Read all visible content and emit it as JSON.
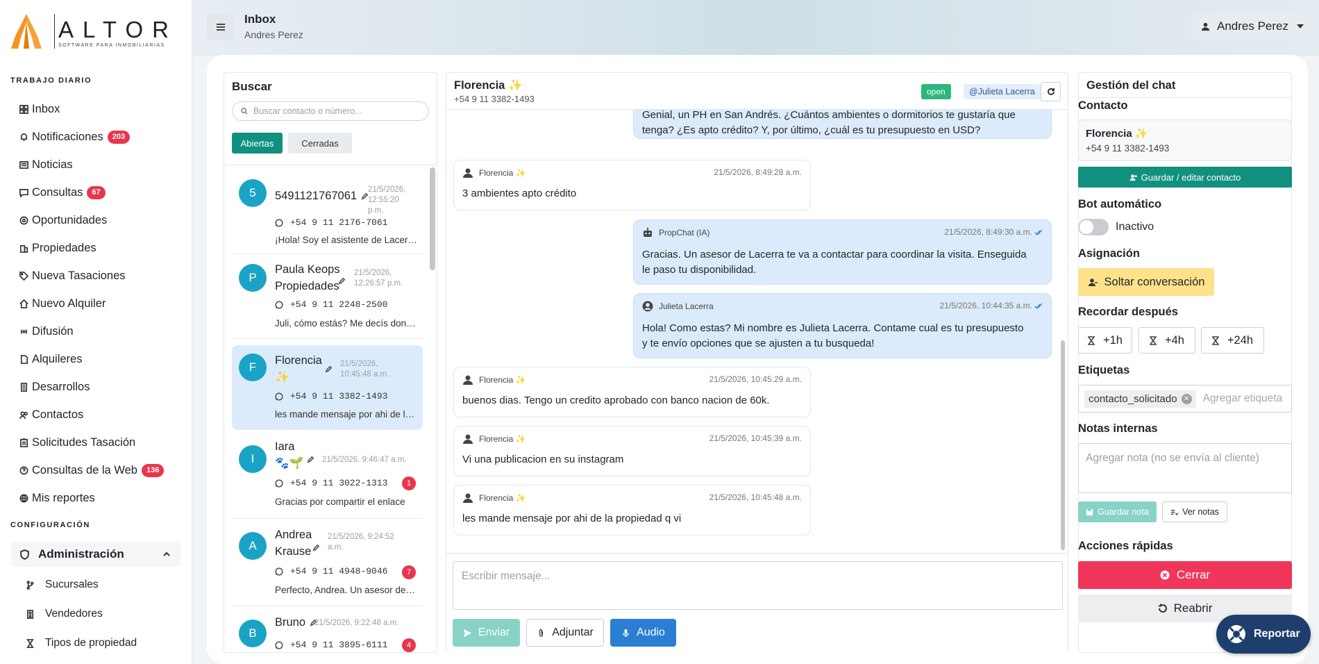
{
  "brand": {
    "name": "ALTOR",
    "tagline": "SOFTWARE PARA INMOBILIARIAS"
  },
  "sidebar": {
    "section_daily": "TRABAJO DIARIO",
    "section_config": "CONFIGURACIÓN",
    "items": [
      {
        "label": "Inbox",
        "icon": "grid-icon"
      },
      {
        "label": "Notificaciones",
        "icon": "bell-icon",
        "badge": "203"
      },
      {
        "label": "Noticias",
        "icon": "newspaper-icon"
      },
      {
        "label": "Consultas",
        "icon": "chat-icon",
        "badge": "67"
      },
      {
        "label": "Oportunidades",
        "icon": "target-icon"
      },
      {
        "label": "Propiedades",
        "icon": "building-icon"
      },
      {
        "label": "Nueva Tasaciones",
        "icon": "tag-icon"
      },
      {
        "label": "Nuevo Alquiler",
        "icon": "house-icon"
      },
      {
        "label": "Difusión",
        "icon": "broadcast-icon"
      },
      {
        "label": "Alquileres",
        "icon": "file-icon"
      },
      {
        "label": "Desarrollos",
        "icon": "building-2-icon"
      },
      {
        "label": "Contactos",
        "icon": "users-icon"
      },
      {
        "label": "Solicitudes Tasación",
        "icon": "clipboard-icon"
      },
      {
        "label": "Consultas de la Web",
        "icon": "question-icon",
        "badge": "136"
      },
      {
        "label": "Mis reportes",
        "icon": "globe-icon"
      }
    ],
    "admin_label": "Administración",
    "admin_items": [
      {
        "label": "Sucursales",
        "icon": "branch-icon"
      },
      {
        "label": "Vendedores",
        "icon": "id-card-icon"
      },
      {
        "label": "Tipos de propiedad",
        "icon": "hourglass-icon"
      }
    ]
  },
  "header": {
    "title": "Inbox",
    "subtitle": "Andres Perez",
    "user": "Andres Perez"
  },
  "list": {
    "title": "Buscar",
    "search_placeholder": "Buscar contacto o número...",
    "tab_open": "Abiertas",
    "tab_closed": "Cerradas",
    "conversations": [
      {
        "initial": "5",
        "name1": "5491121767061",
        "name2": "",
        "date1": "21/5/2026,",
        "date2": "12:55:20",
        "date3": "p.m.",
        "phone": "+54 9 11 2176-7061",
        "preview": "¡Hola! Soy el asistente de Lacerra Propiedades",
        "badge": ""
      },
      {
        "initial": "P",
        "name1": "Paula Keops",
        "name2": "Propiedades",
        "date1": "21/5/2026,",
        "date2": "12:26:57 p.m.",
        "date3": "",
        "phone": "+54 9 11 2248-2500",
        "preview": "Juli, cómo estás? Me decís donde queda",
        "badge": ""
      },
      {
        "initial": "F",
        "name1": "Florencia",
        "name2": "✨",
        "date1": "21/5/2026,",
        "date2": "10:45:48 a.m.",
        "date3": "",
        "phone": "+54 9 11 3382-1493",
        "preview": "les mande mensaje por ahi de la propiedad",
        "badge": ""
      },
      {
        "initial": "I",
        "name1": "Iara",
        "name2": "🐾🌱",
        "date1": "21/5/2026, 9:46:47 a.m.",
        "date2": "",
        "date3": "",
        "phone": "+54 9 11 3022-1313",
        "preview": "Gracias por compartir el enlace",
        "badge": "1"
      },
      {
        "initial": "A",
        "name1": "Andrea",
        "name2": "Krause",
        "date1": "21/5/2026, 9:24:52",
        "date2": "a.m.",
        "date3": "",
        "phone": "+54 9 11 4948-9046",
        "preview": "Perfecto, Andrea. Un asesor de Lacerra",
        "badge": "7"
      },
      {
        "initial": "B",
        "name1": "Bruno",
        "name2": "",
        "date1": "21/5/2026, 9:22:48 a.m.",
        "date2": "",
        "date3": "",
        "phone": "+54 9 11 3895-6111",
        "preview": "",
        "badge": "4"
      }
    ]
  },
  "chat": {
    "name": "Florencia",
    "sparkle": "✨",
    "phone": "+54 9 11 3382-1493",
    "status": "open",
    "assignee": "@Julieta Lacerra",
    "messages": [
      {
        "dir": "out",
        "sender": "",
        "time": "",
        "text1": "Genial, un PH en San Andrés. ¿Cuántos ambientes o dormitorios te gustaría que",
        "text2": "tenga? ¿Es apto crédito? Y, por último, ¿cuál es tu presupuesto en USD?"
      },
      {
        "dir": "in",
        "sender": "Florencia ✨",
        "time": "21/5/2026, 8:49:28 a.m.",
        "text1": "3 ambientes apto crédito",
        "text2": ""
      },
      {
        "dir": "out",
        "sender": "PropChat (IA)",
        "time": "21/5/2026, 8:49:30 a.m.",
        "text1": "Gracias. Un asesor de Lacerra te va a contactar para coordinar la visita. Enseguida",
        "text2": "le paso tu disponibilidad."
      },
      {
        "dir": "out",
        "sender": "Julieta Lacerra",
        "time": "21/5/2026, 10:44:35 a.m.",
        "text1": "Hola! Como estas? Mi nombre es Julieta Lacerra. Contame cual es tu presupuesto",
        "text2": "y te envío opciones que se ajusten a tu busqueda!"
      },
      {
        "dir": "in",
        "sender": "Florencia ✨",
        "time": "21/5/2026, 10:45:29 a.m.",
        "text1": "buenos dias. Tengo un credito aprobado con banco nacion de 60k.",
        "text2": ""
      },
      {
        "dir": "in",
        "sender": "Florencia ✨",
        "time": "21/5/2026, 10:45:39 a.m.",
        "text1": "Vi una publicacion en su instagram",
        "text2": ""
      },
      {
        "dir": "in",
        "sender": "Florencia ✨",
        "time": "21/5/2026, 10:45:48 a.m.",
        "text1": "les mande mensaje por ahi de la propiedad q vi",
        "text2": ""
      }
    ],
    "compose_placeholder": "Escribir mensaje...",
    "send": "Enviar",
    "attach": "Adjuntar",
    "audio": "Audio"
  },
  "manage": {
    "title": "Gestión del chat",
    "contact_label": "Contacto",
    "contact_name": "Florencia ✨",
    "contact_phone": "+54 9 11 3382-1493",
    "save_contact": "Guardar / editar contacto",
    "bot_label": "Bot automático",
    "bot_state": "Inactivo",
    "assign_label": "Asignación",
    "release": "Soltar conversación",
    "remind_label": "Recordar después",
    "remind": [
      "+1h",
      "+4h",
      "+24h"
    ],
    "tags_label": "Etiquetas",
    "tag": "contacto_solicitado",
    "tag_placeholder": "Agregar etiqueta",
    "notes_label": "Notas internas",
    "notes_placeholder": "Agregar nota (no se envía al cliente)",
    "save_note": "Guardar nota",
    "see_notes": "Ver notas",
    "quick_label": "Acciones rápidas",
    "close": "Cerrar",
    "reopen": "Reabrir"
  },
  "report": "Reportar",
  "colors": {
    "primary": "#12907f",
    "danger": "#f0365a",
    "warning": "#fde28a",
    "info": "#2a7fd4",
    "navy": "#1e3f6e"
  }
}
